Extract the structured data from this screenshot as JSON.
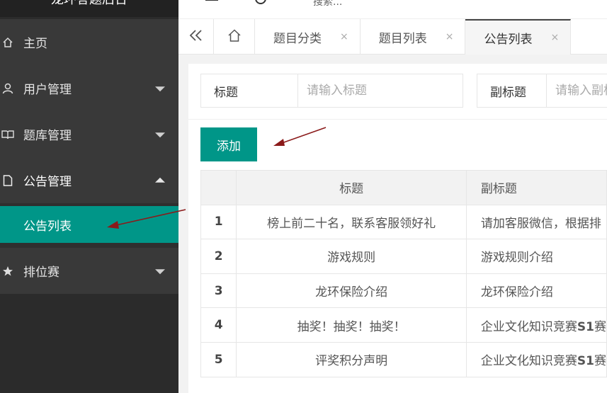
{
  "app": {
    "brand": "龙环答题后台"
  },
  "header": {
    "search_hint": "搜索..."
  },
  "sidebar": {
    "items": [
      {
        "label": "主页",
        "icon": "home-icon",
        "has_caret": false
      },
      {
        "label": "用户管理",
        "icon": "user-icon",
        "has_caret": true
      },
      {
        "label": "题库管理",
        "icon": "book-icon",
        "has_caret": true
      },
      {
        "label": "公告管理",
        "icon": "file-icon",
        "has_caret": true,
        "expanded": true
      },
      {
        "label": "排位赛",
        "icon": "star-icon",
        "has_caret": true
      }
    ],
    "active_sub": "公告列表"
  },
  "tabs": [
    {
      "label": "题目分类",
      "close": "×"
    },
    {
      "label": "题目列表",
      "close": "×"
    },
    {
      "label": "公告列表",
      "close": "×",
      "active": true
    }
  ],
  "search": {
    "title_label": "标题",
    "title_placeholder": "请输入标题",
    "subtitle_label": "副标题",
    "subtitle_placeholder": "请输入副标题"
  },
  "toolbar": {
    "add_label": "添加"
  },
  "table": {
    "headers": [
      "",
      "标题",
      "副标题"
    ],
    "rows": [
      {
        "num": "1",
        "title": "榜上前二十名，联系客服领好礼",
        "sub": "请加客服微信，根据排"
      },
      {
        "num": "2",
        "title": "游戏规则",
        "sub": "游戏规则介绍"
      },
      {
        "num": "3",
        "title": "龙环保险介绍",
        "sub": "龙环保险介绍"
      },
      {
        "num": "4",
        "title": "抽奖！抽奖！抽奖！",
        "sub_pre": "企业文化知识竞赛",
        "sub_bold": "S1",
        "sub_post": "赛"
      },
      {
        "num": "5",
        "title": "评奖积分声明",
        "sub_pre": "企业文化知识竞赛",
        "sub_bold": "S1",
        "sub_post": "赛"
      }
    ]
  },
  "colors": {
    "accent": "#009688",
    "sidebar_bg": "#393939",
    "arrow": "#8b1a1a"
  }
}
